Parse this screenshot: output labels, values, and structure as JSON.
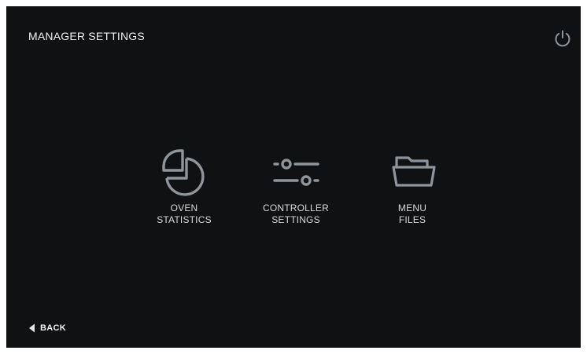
{
  "header": {
    "title": "MANAGER SETTINGS",
    "power_icon": "power-icon"
  },
  "tiles": [
    {
      "icon": "pie-chart-icon",
      "line1": "OVEN",
      "line2": "STATISTICS"
    },
    {
      "icon": "sliders-icon",
      "line1": "CONTROLLER",
      "line2": "SETTINGS"
    },
    {
      "icon": "folder-open-icon",
      "line1": "MENU",
      "line2": "FILES"
    }
  ],
  "footer": {
    "back_label": "BACK",
    "back_icon": "triangle-left-icon"
  },
  "colors": {
    "background": "#0f1112",
    "text": "#e6e7e8",
    "icon": "#8e959b"
  }
}
